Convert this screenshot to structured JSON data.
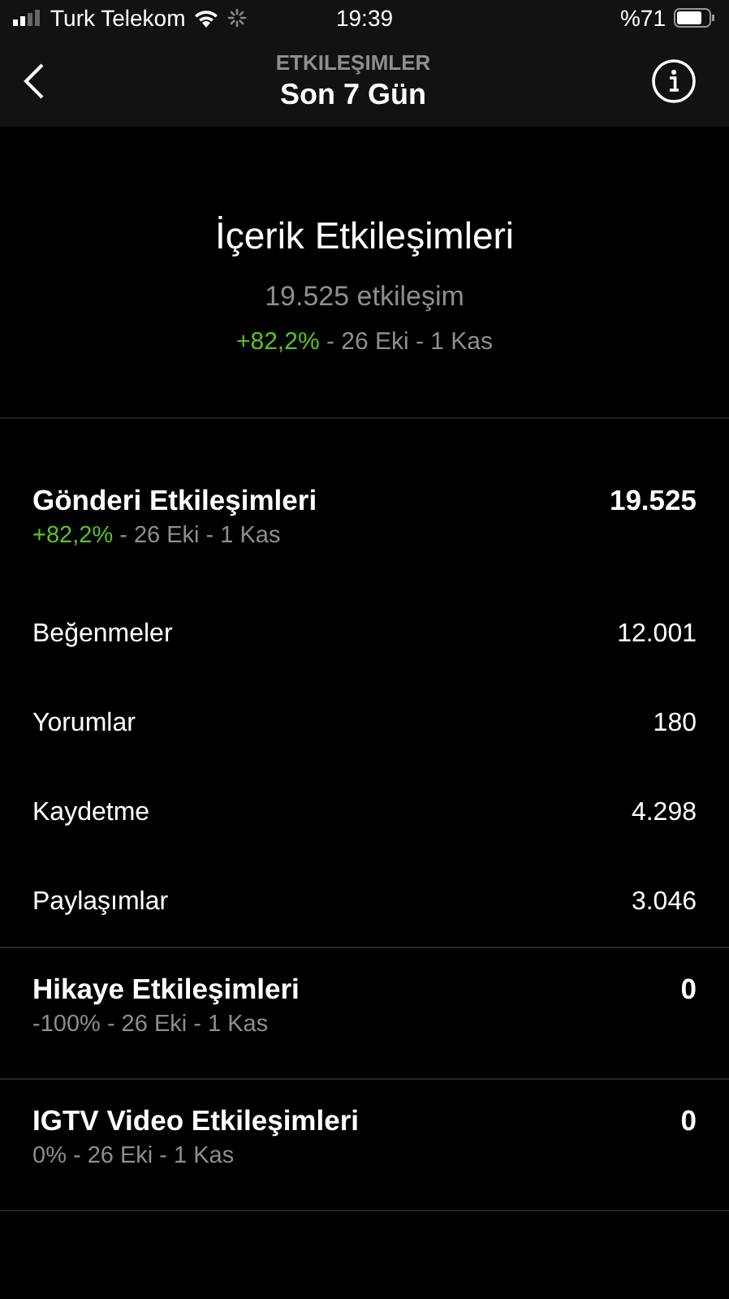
{
  "status_bar": {
    "carrier": "Turk Telekom",
    "time": "19:39",
    "battery": "%71"
  },
  "nav": {
    "subtitle": "ETKILEŞIMLER",
    "title": "Son 7 Gün"
  },
  "summary": {
    "title": "İçerik Etkileşimleri",
    "total": "19.525 etkileşim",
    "change": "+82,2%",
    "positive": true,
    "period": "- 26 Eki - 1 Kas"
  },
  "sections": [
    {
      "title": "Gönderi Etkileşimleri",
      "value": "19.525",
      "change": "+82,2%",
      "positive": true,
      "period": "- 26 Eki - 1 Kas",
      "rows": [
        {
          "label": "Beğenmeler",
          "value": "12.001"
        },
        {
          "label": "Yorumlar",
          "value": "180"
        },
        {
          "label": "Kaydetme",
          "value": "4.298"
        },
        {
          "label": "Paylaşımlar",
          "value": "3.046"
        }
      ]
    },
    {
      "title": "Hikaye Etkileşimleri",
      "value": "0",
      "change": "-100%",
      "positive": false,
      "period": "- 26 Eki - 1 Kas"
    },
    {
      "title": "IGTV Video Etkileşimleri",
      "value": "0",
      "change": "0%",
      "positive": false,
      "period": "- 26 Eki - 1 Kas"
    }
  ]
}
